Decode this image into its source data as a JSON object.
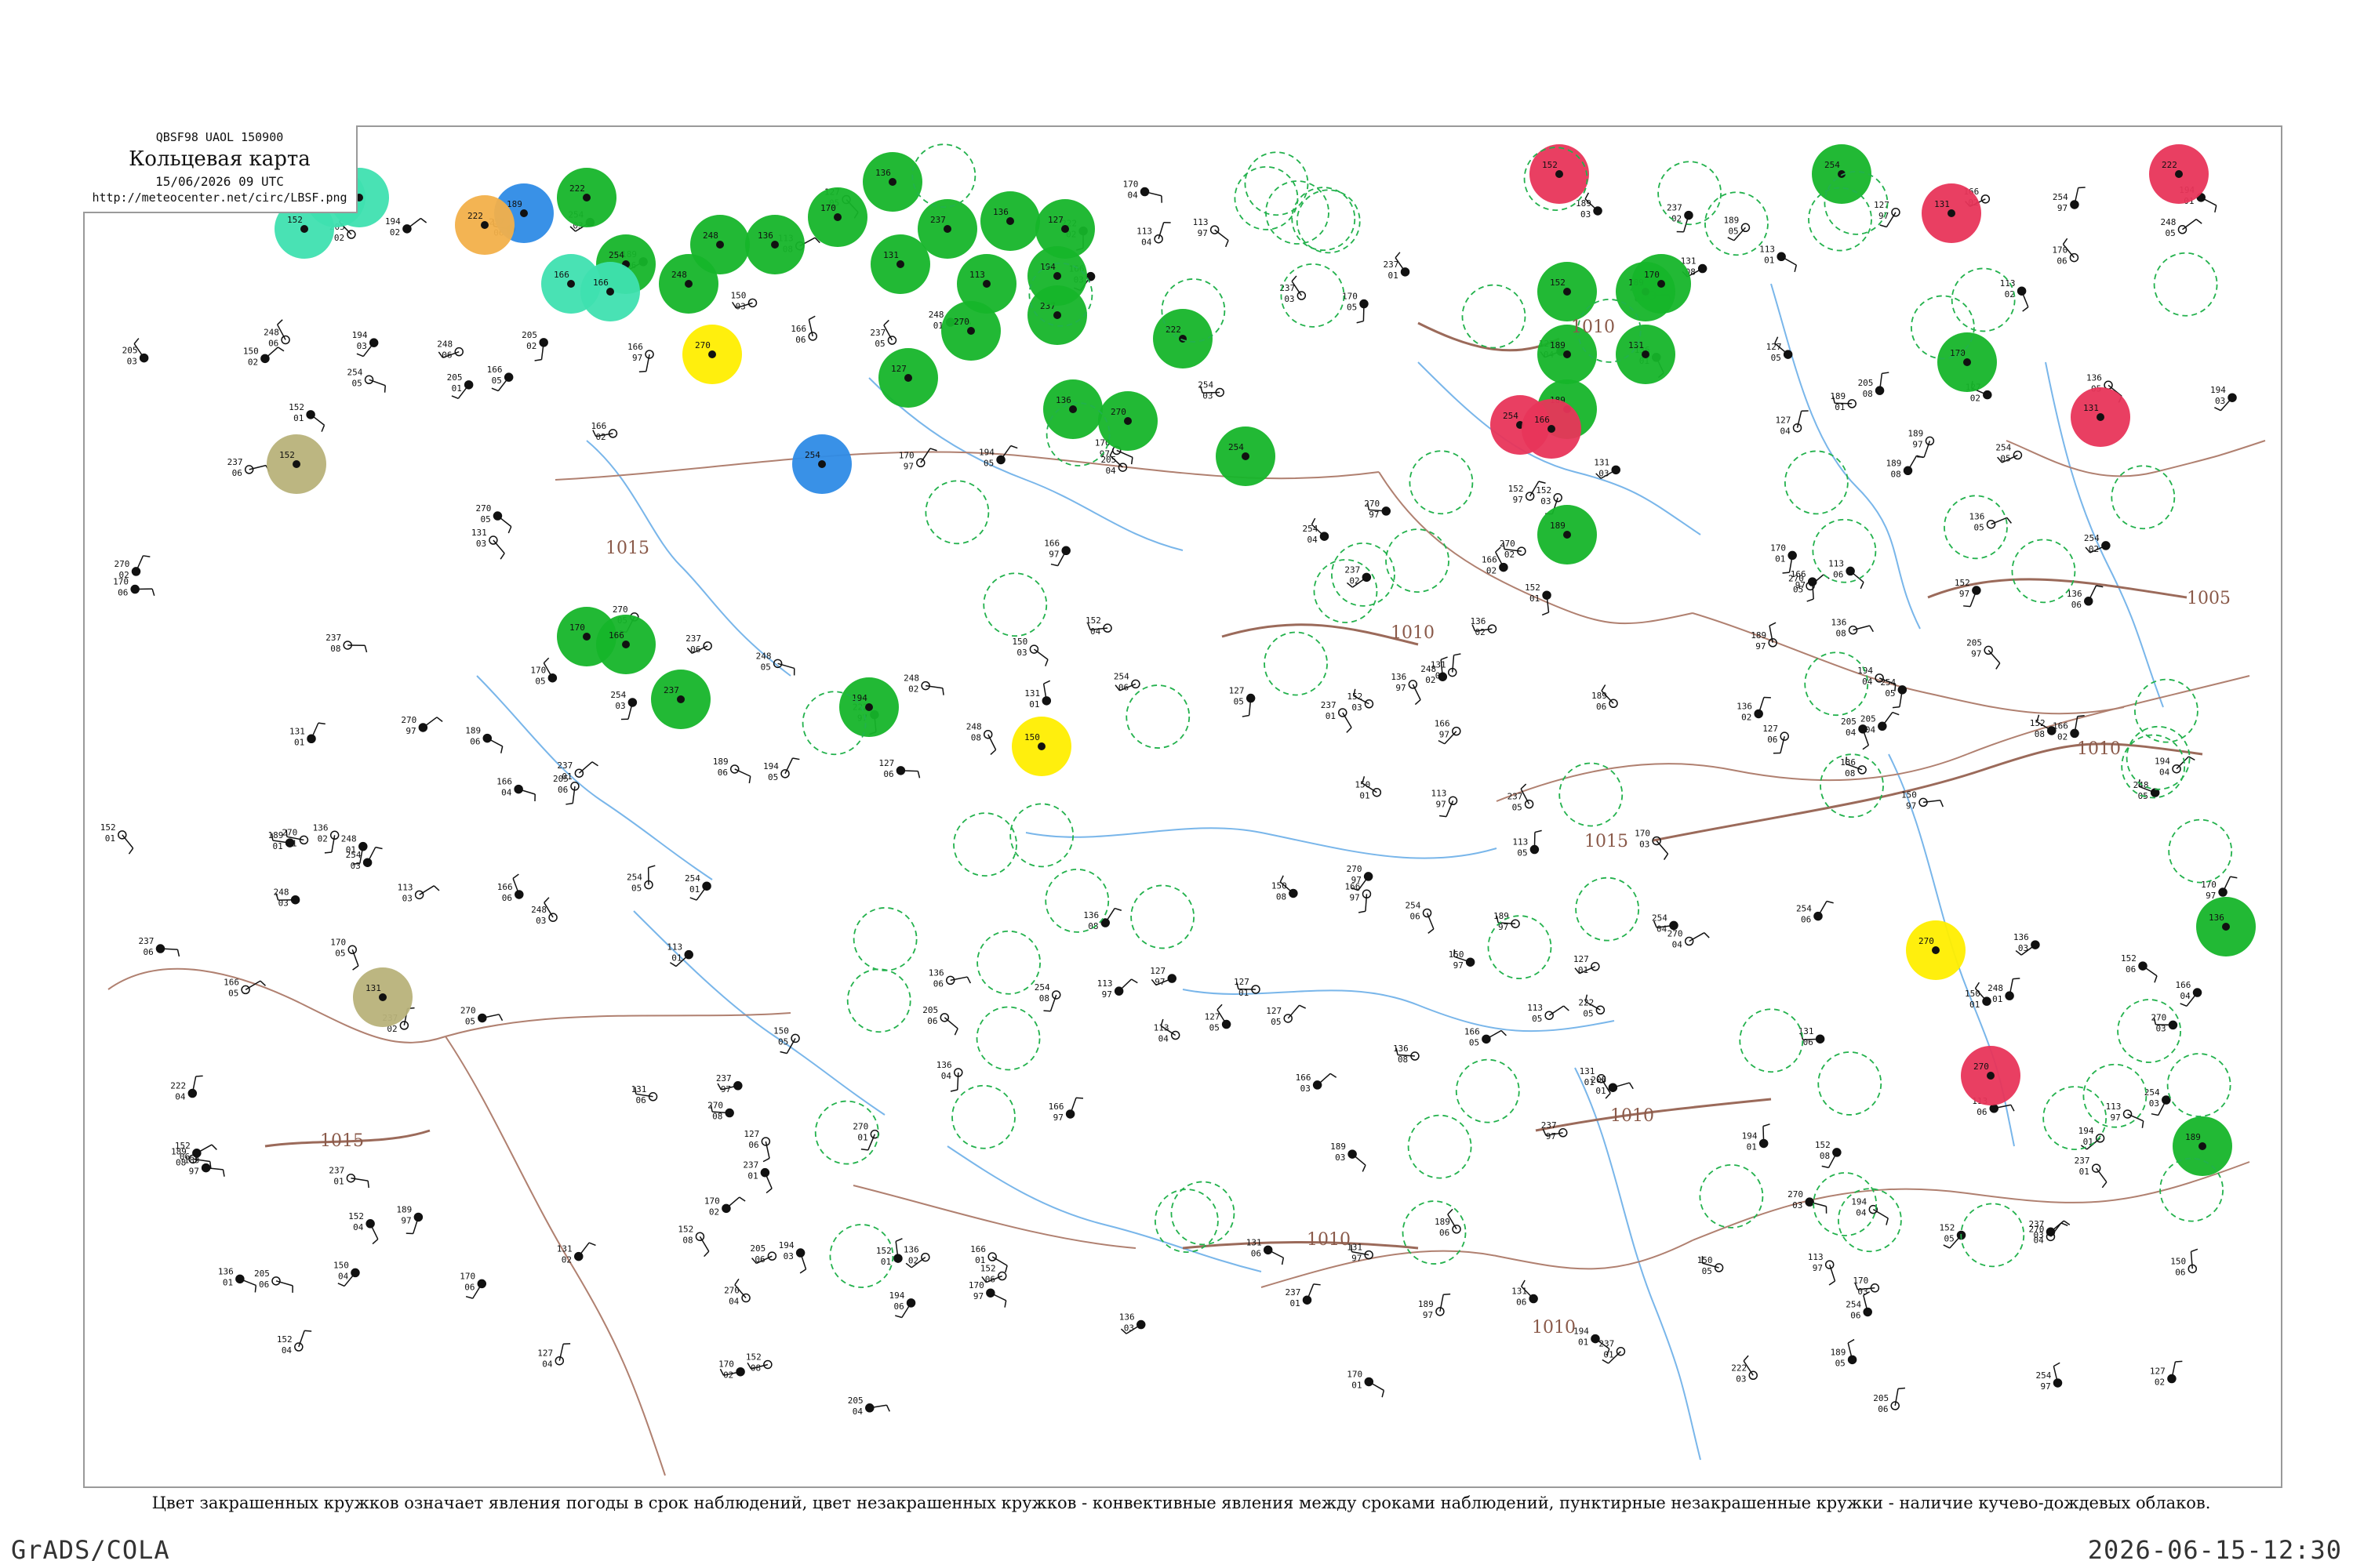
{
  "header": {
    "code_line": "QBSF98  UAOL  150900",
    "title": "Кольцевая карта",
    "date": "15/06/2026 09 UTC",
    "url": "http://meteocenter.net/circ/LBSF.png"
  },
  "legend_note": "Цвет закрашенных кружков означает явления погоды в срок наблюдений, цвет незакрашенных кружков - конвективные явления между сроками наблюдений, пунктирные незакрашенные кружки - наличие кучево-дождевых облаков.",
  "footer": {
    "left": "GrADS/COLA",
    "right": "2026-06-15-12:30"
  },
  "colors": {
    "rain_fill": "#16b52a",
    "thunder_fill": "#e8355a",
    "shower_fill": "#2e8be6",
    "drizzle_fill": "#3fe0b0",
    "haze_fill": "#ffee00",
    "fog_fill": "#f2b04a",
    "dust_fill": "#b8b27a",
    "cb_dashed": "#22b14c",
    "isobar": "#9b6a5a",
    "river": "#79b6ea"
  },
  "isobar_labels": [
    "1005",
    "1010",
    "1015"
  ],
  "weather_circles": [
    {
      "type": "rain",
      "lon_lat": [
        28,
        65
      ]
    },
    {
      "type": "thunder",
      "lon_lat": [
        52,
        64
      ]
    },
    {
      "type": "shower",
      "lon_lat": [
        20,
        63
      ]
    },
    {
      "type": "haze",
      "lon_lat": [
        25,
        58
      ]
    },
    {
      "type": "fog",
      "lon_lat": [
        15,
        66
      ]
    },
    {
      "type": "dust",
      "lon_lat": [
        -8,
        55
      ]
    }
  ],
  "stations": [
    {
      "p": "136",
      "t": "97",
      "id": ""
    },
    {
      "p": "152",
      "t": "97",
      "id": ""
    },
    {
      "p": "189",
      "t": "97",
      "id": ""
    },
    {
      "p": "205",
      "t": "97",
      "id": ""
    },
    {
      "p": "131",
      "t": "97",
      "id": ""
    },
    {
      "p": "150",
      "t": "97",
      "id": ""
    },
    {
      "p": "248",
      "t": "97",
      "id": ""
    },
    {
      "p": "270",
      "t": "97",
      "id": ""
    }
  ]
}
